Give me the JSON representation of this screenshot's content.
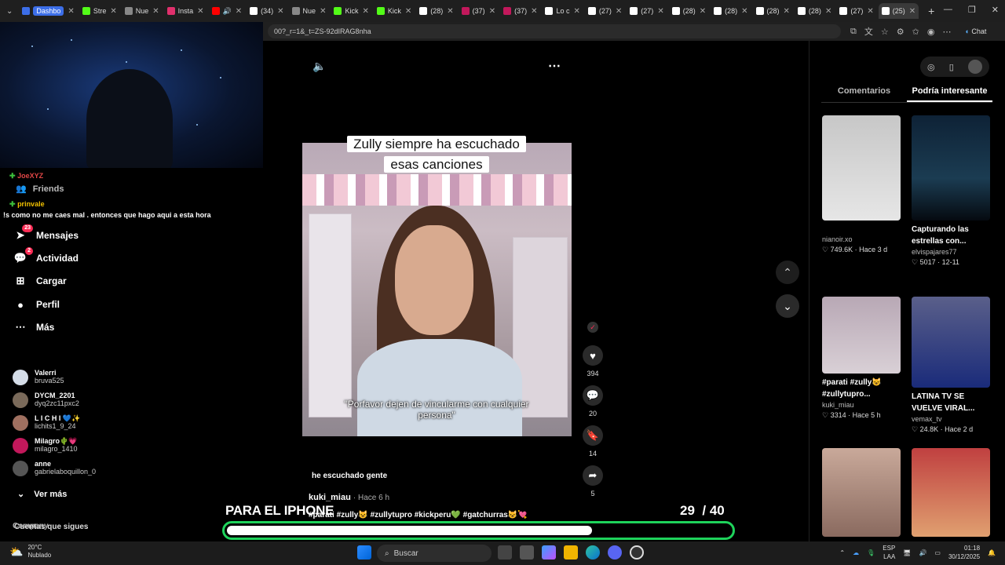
{
  "browser": {
    "tabs": [
      {
        "label": "Dashbo",
        "color": "#3c6ee8",
        "active": false,
        "chip": true
      },
      {
        "label": "Stre",
        "color": "#53fc18"
      },
      {
        "label": "Nue",
        "color": "#888888"
      },
      {
        "label": "Insta",
        "color": "#e1306c"
      },
      {
        "label": "",
        "color": "#ff0000",
        "audio": true
      },
      {
        "label": "(34)",
        "color": "#ffffff"
      },
      {
        "label": "Nue",
        "color": "#888888"
      },
      {
        "label": "Kick",
        "color": "#53fc18"
      },
      {
        "label": "Kick",
        "color": "#53fc18"
      },
      {
        "label": "(28)",
        "color": "#ffffff"
      },
      {
        "label": "(37)",
        "color": "#c2185b"
      },
      {
        "label": "(37)",
        "color": "#c2185b"
      },
      {
        "label": "Lo c",
        "color": "#ffffff"
      },
      {
        "label": "(27)",
        "color": "#ffffff"
      },
      {
        "label": "(27)",
        "color": "#ffffff"
      },
      {
        "label": "(28)",
        "color": "#ffffff"
      },
      {
        "label": "(28)",
        "color": "#ffffff"
      },
      {
        "label": "(28)",
        "color": "#ffffff"
      },
      {
        "label": "(28)",
        "color": "#ffffff"
      },
      {
        "label": "(27)",
        "color": "#ffffff"
      },
      {
        "label": "(25)",
        "color": "#ffffff",
        "active": true
      }
    ],
    "url": "00?_r=1&_t=ZS-92dIRAG8nha",
    "chat_label": "Chat"
  },
  "stream_chat": [
    {
      "text": "JoeXYZ",
      "color": "#e04646"
    },
    {
      "text": "prinvale",
      "color": "#f0c000"
    },
    {
      "text": "!s como no me caes mal . entonces que hago aqui a esta hora",
      "color": "#ffffff"
    }
  ],
  "sidebar": {
    "friends_label": "Friends",
    "items": [
      {
        "label": "Mensajes",
        "icon": "paper-plane-icon",
        "glyph": "➤",
        "badge": "23"
      },
      {
        "label": "Actividad",
        "icon": "chat-bubble-icon",
        "glyph": "💬",
        "badge": "2"
      },
      {
        "label": "Cargar",
        "icon": "plus-box-icon",
        "glyph": "⊞",
        "badge": ""
      },
      {
        "label": "Perfil",
        "icon": "avatar-icon",
        "glyph": "●",
        "badge": ""
      },
      {
        "label": "Más",
        "icon": "more-icon",
        "glyph": "⋯",
        "badge": ""
      }
    ],
    "following_title": "Cuentas que sigues",
    "following": [
      {
        "name": "Valerri",
        "handle": "bruva525",
        "color": "#d5dde8"
      },
      {
        "name": "DYCM_2201",
        "handle": "dyq2zc11pxc2",
        "color": "#7a6a5a"
      },
      {
        "name": "L I C H I 💙✨",
        "handle": "lichits1_9_24",
        "color": "#a07060"
      },
      {
        "name": "Milagro🌵💗",
        "handle": "milagro_1410",
        "color": "#c2185b"
      },
      {
        "name": "anne",
        "handle": "gabrielaboquillon_0",
        "color": "#555555"
      }
    ],
    "see_more": "Ver más",
    "company": "Company"
  },
  "video": {
    "caption_top": "Zully siempre ha escuchado esas canciones",
    "caption_bottom": "\"Porfavor dejen de vincularme con cualquier persona\"",
    "description": "he escuchado gente",
    "author": "kuki_miau",
    "time": "Hace 6 h",
    "hashtags": "#parati #zully😺 #zullytupro #kickperu💚 #gatchurras😺💘",
    "likes": "394",
    "comments": "20",
    "saves": "14",
    "shares": "5"
  },
  "overlay": {
    "title": "PARA EL IPHONE",
    "current": "29",
    "total": "/ 40",
    "progress_fraction": 0.725,
    "progress_border": "#1ed35b"
  },
  "right_panel": {
    "tab_comments": "Comentarios",
    "tab_interesting": "Podría interesante",
    "cards": [
      {
        "title": "",
        "user": "nianoir.xo",
        "meta": "♡ 749.6K · Hace 3 d",
        "bg": "linear-gradient(180deg,#c7c7c7,#e6e6e6)"
      },
      {
        "title": "Capturando las estrellas con...",
        "user": "elvispajares77",
        "meta": "♡ 5017 · 12-11",
        "bg": "linear-gradient(180deg,#0e2236,#1b3c52 60%,#050a10)"
      },
      {
        "title": "#parati #zully😺 #zullytupro...",
        "user": "kuki_miau",
        "meta": "♡ 3314 · Hace 5 h",
        "bg": "linear-gradient(180deg,#b8a8b5,#d9d0d6)"
      },
      {
        "title": "LATINA TV SE VUELVE VIRAL...",
        "user": "vemax_tv",
        "meta": "♡ 24.8K · Hace 2 d",
        "bg": "linear-gradient(180deg,#5a5f8a,#1a2b7a)"
      },
      {
        "title": "",
        "user": "",
        "meta": "",
        "bg": "linear-gradient(180deg,#c9a99a,#8a6a5f)"
      },
      {
        "title": "",
        "user": "",
        "meta": "",
        "bg": "linear-gradient(180deg,#c04040,#e0a070)"
      }
    ]
  },
  "taskbar": {
    "temp": "20°C",
    "weather": "Nublado",
    "search": "Buscar",
    "lang": "ESP",
    "lang2": "LAA",
    "time": "01:18",
    "date": "30/12/2025"
  }
}
